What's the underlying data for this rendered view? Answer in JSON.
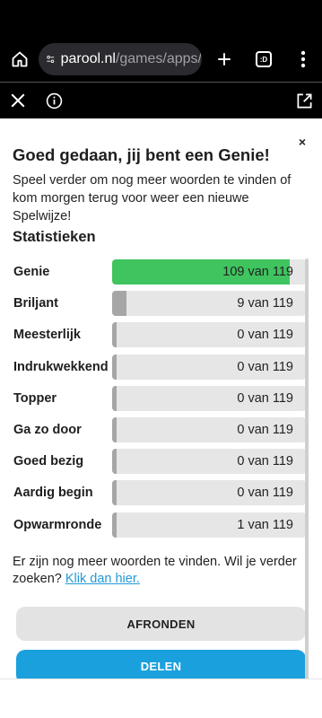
{
  "browser": {
    "url_host": "parool.nl",
    "url_path": "/games/apps/",
    "tab_count": ":D"
  },
  "dialog": {
    "close_label": "×",
    "title": "Goed gedaan, jij bent een Genie!",
    "description": "Speel verder om nog meer woorden te vinden of kom morgen terug voor weer een nieuwe Spelwijze!",
    "stats_heading": "Statistieken",
    "rows": [
      {
        "label": "Genie",
        "value": "109 van 119",
        "fraction": 0.916
      },
      {
        "label": "Briljant",
        "value": "9 van 119",
        "fraction": 0.076
      },
      {
        "label": "Meesterlijk",
        "value": "0 van 119",
        "fraction": 0
      },
      {
        "label": "Indrukwekkend",
        "value": "0 van 119",
        "fraction": 0
      },
      {
        "label": "Topper",
        "value": "0 van 119",
        "fraction": 0
      },
      {
        "label": "Ga zo door",
        "value": "0 van 119",
        "fraction": 0
      },
      {
        "label": "Goed bezig",
        "value": "0 van 119",
        "fraction": 0
      },
      {
        "label": "Aardig begin",
        "value": "0 van 119",
        "fraction": 0
      },
      {
        "label": "Opwarmronde",
        "value": "1 van 119",
        "fraction": 0.008
      }
    ],
    "more_text": "Er zijn nog meer woorden te vinden. Wil je verder zoeken? ",
    "more_link": "Klik dan hier.",
    "finish_label": "AFRONDEN",
    "share_label": "DELEN"
  },
  "colors": {
    "genie_bar": "#3fc45f",
    "rank_bar": "#a6a6a6",
    "share_button": "#1aa0dd",
    "link": "#1f9ad6"
  }
}
